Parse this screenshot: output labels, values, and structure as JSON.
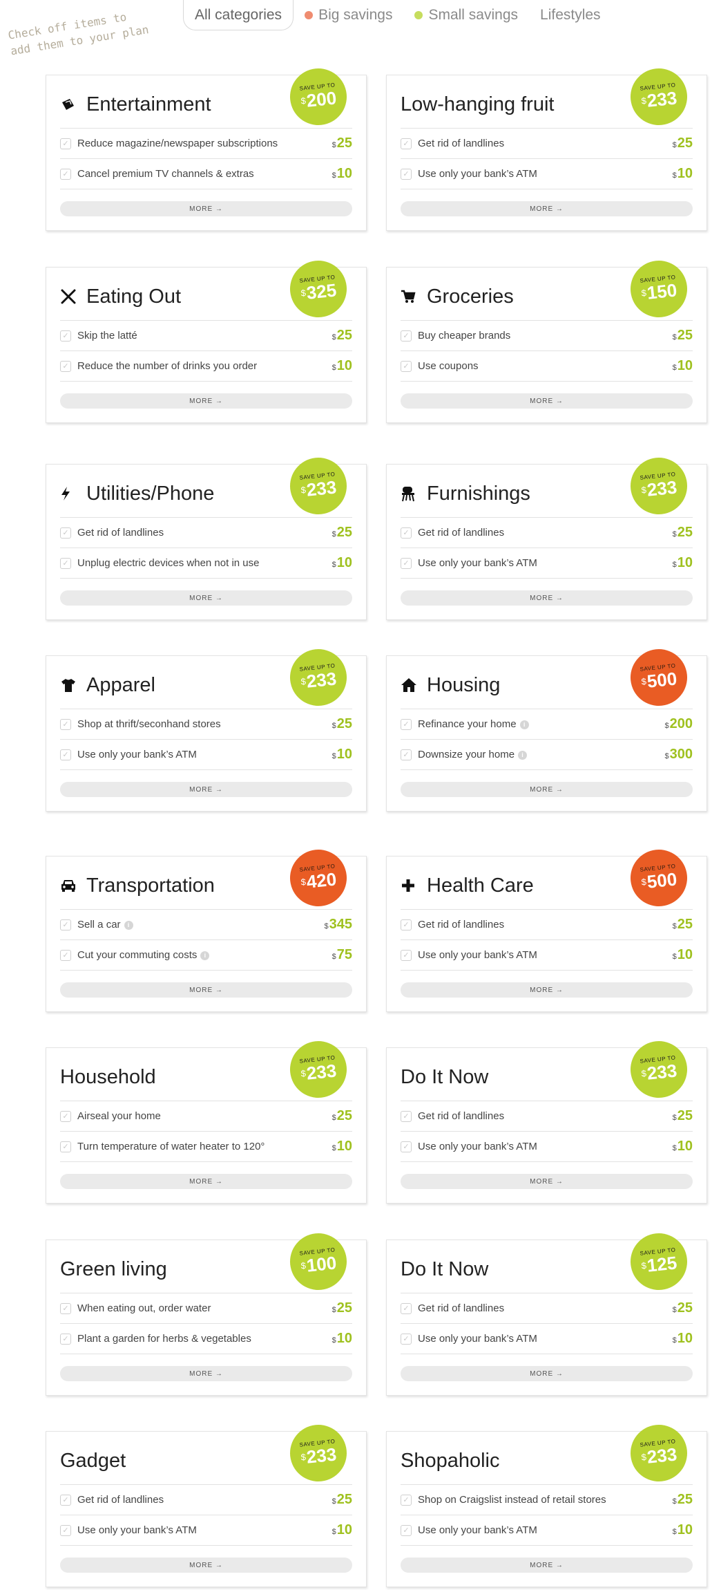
{
  "filters": [
    {
      "label": "All categories",
      "dot": ""
    },
    {
      "label": "Big savings",
      "dot": "#ef8c70"
    },
    {
      "label": "Small savings",
      "dot": "#c6dd5e"
    },
    {
      "label": "Lifestyles",
      "dot": ""
    }
  ],
  "hint": "Check off items to\nadd them to your plan",
  "save_label": "SAVE UP TO",
  "currency": "$",
  "more_label": "MORE →",
  "colors": {
    "green": "#b8d432",
    "orange": "#e95c24",
    "amount": "#9fc11f"
  },
  "cards": [
    {
      "title": "Entertainment",
      "icon": "ticket-icon",
      "save": "200",
      "badge_color": "green",
      "items": [
        {
          "label": "Reduce magazine/newspaper subscriptions",
          "amount": "25",
          "info": false
        },
        {
          "label": "Cancel premium TV channels & extras",
          "amount": "10",
          "info": false
        }
      ]
    },
    {
      "title": "Low-hanging fruit",
      "icon": "",
      "save": "233",
      "badge_color": "green",
      "items": [
        {
          "label": "Get rid of landlines",
          "amount": "25",
          "info": false
        },
        {
          "label": "Use only your bank’s ATM",
          "amount": "10",
          "info": false
        }
      ]
    },
    {
      "title": "Eating Out",
      "icon": "utensils-icon",
      "save": "325",
      "badge_color": "green",
      "items": [
        {
          "label": "Skip the latté",
          "amount": "25",
          "info": false
        },
        {
          "label": "Reduce the number of drinks you order",
          "amount": "10",
          "info": false
        }
      ]
    },
    {
      "title": "Groceries",
      "icon": "cart-icon",
      "save": "150",
      "badge_color": "green",
      "items": [
        {
          "label": "Buy cheaper brands",
          "amount": "25",
          "info": false
        },
        {
          "label": "Use coupons",
          "amount": "10",
          "info": false
        }
      ]
    },
    {
      "title": "Utilities/Phone",
      "icon": "lightning-icon",
      "save": "233",
      "badge_color": "green",
      "items": [
        {
          "label": "Get rid of landlines",
          "amount": "25",
          "info": false
        },
        {
          "label": "Unplug electric devices when not in use",
          "amount": "10",
          "info": false
        }
      ]
    },
    {
      "title": "Furnishings",
      "icon": "chair-icon",
      "save": "233",
      "badge_color": "green",
      "items": [
        {
          "label": "Get rid of landlines",
          "amount": "25",
          "info": false
        },
        {
          "label": "Use only your bank’s ATM",
          "amount": "10",
          "info": false
        }
      ]
    },
    {
      "title": "Apparel",
      "icon": "shirt-icon",
      "save": "233",
      "badge_color": "green",
      "items": [
        {
          "label": "Shop at thrift/seconhand stores",
          "amount": "25",
          "info": false
        },
        {
          "label": "Use only your bank’s ATM",
          "amount": "10",
          "info": false
        }
      ]
    },
    {
      "title": "Housing",
      "icon": "house-icon",
      "save": "500",
      "badge_color": "orange",
      "items": [
        {
          "label": "Refinance your home",
          "amount": "200",
          "info": true
        },
        {
          "label": "Downsize your home",
          "amount": "300",
          "info": true
        }
      ]
    },
    {
      "title": "Transportation",
      "icon": "car-icon",
      "save": "420",
      "badge_color": "orange",
      "items": [
        {
          "label": "Sell a car",
          "amount": "345",
          "info": true
        },
        {
          "label": "Cut your commuting costs",
          "amount": "75",
          "info": true
        }
      ]
    },
    {
      "title": "Health Care",
      "icon": "plus-icon",
      "save": "500",
      "badge_color": "orange",
      "items": [
        {
          "label": "Get rid of landlines",
          "amount": "25",
          "info": false
        },
        {
          "label": "Use only your bank’s ATM",
          "amount": "10",
          "info": false
        }
      ]
    },
    {
      "title": "Household",
      "icon": "",
      "save": "233",
      "badge_color": "green",
      "items": [
        {
          "label": "Airseal your home",
          "amount": "25",
          "info": false
        },
        {
          "label": "Turn temperature of water heater to 120°",
          "amount": "10",
          "info": false
        }
      ]
    },
    {
      "title": "Do It Now",
      "icon": "",
      "save": "233",
      "badge_color": "green",
      "items": [
        {
          "label": "Get rid of landlines",
          "amount": "25",
          "info": false
        },
        {
          "label": "Use only your bank’s ATM",
          "amount": "10",
          "info": false
        }
      ]
    },
    {
      "title": "Green living",
      "icon": "",
      "save": "100",
      "badge_color": "green",
      "items": [
        {
          "label": "When eating out, order water",
          "amount": "25",
          "info": false
        },
        {
          "label": "Plant a garden for herbs & vegetables",
          "amount": "10",
          "info": false
        }
      ]
    },
    {
      "title": "Do It Now",
      "icon": "",
      "save": "125",
      "badge_color": "green",
      "items": [
        {
          "label": "Get rid of landlines",
          "amount": "25",
          "info": false
        },
        {
          "label": "Use only your bank’s ATM",
          "amount": "10",
          "info": false
        }
      ]
    },
    {
      "title": "Gadget",
      "icon": "",
      "save": "233",
      "badge_color": "green",
      "items": [
        {
          "label": "Get rid of landlines",
          "amount": "25",
          "info": false
        },
        {
          "label": "Use only your bank’s ATM",
          "amount": "10",
          "info": false
        }
      ]
    },
    {
      "title": "Shopaholic",
      "icon": "",
      "save": "233",
      "badge_color": "green",
      "items": [
        {
          "label": "Shop on Craigslist instead of retail stores",
          "amount": "25",
          "info": false
        },
        {
          "label": "Use only your bank’s ATM",
          "amount": "10",
          "info": false
        }
      ]
    }
  ]
}
